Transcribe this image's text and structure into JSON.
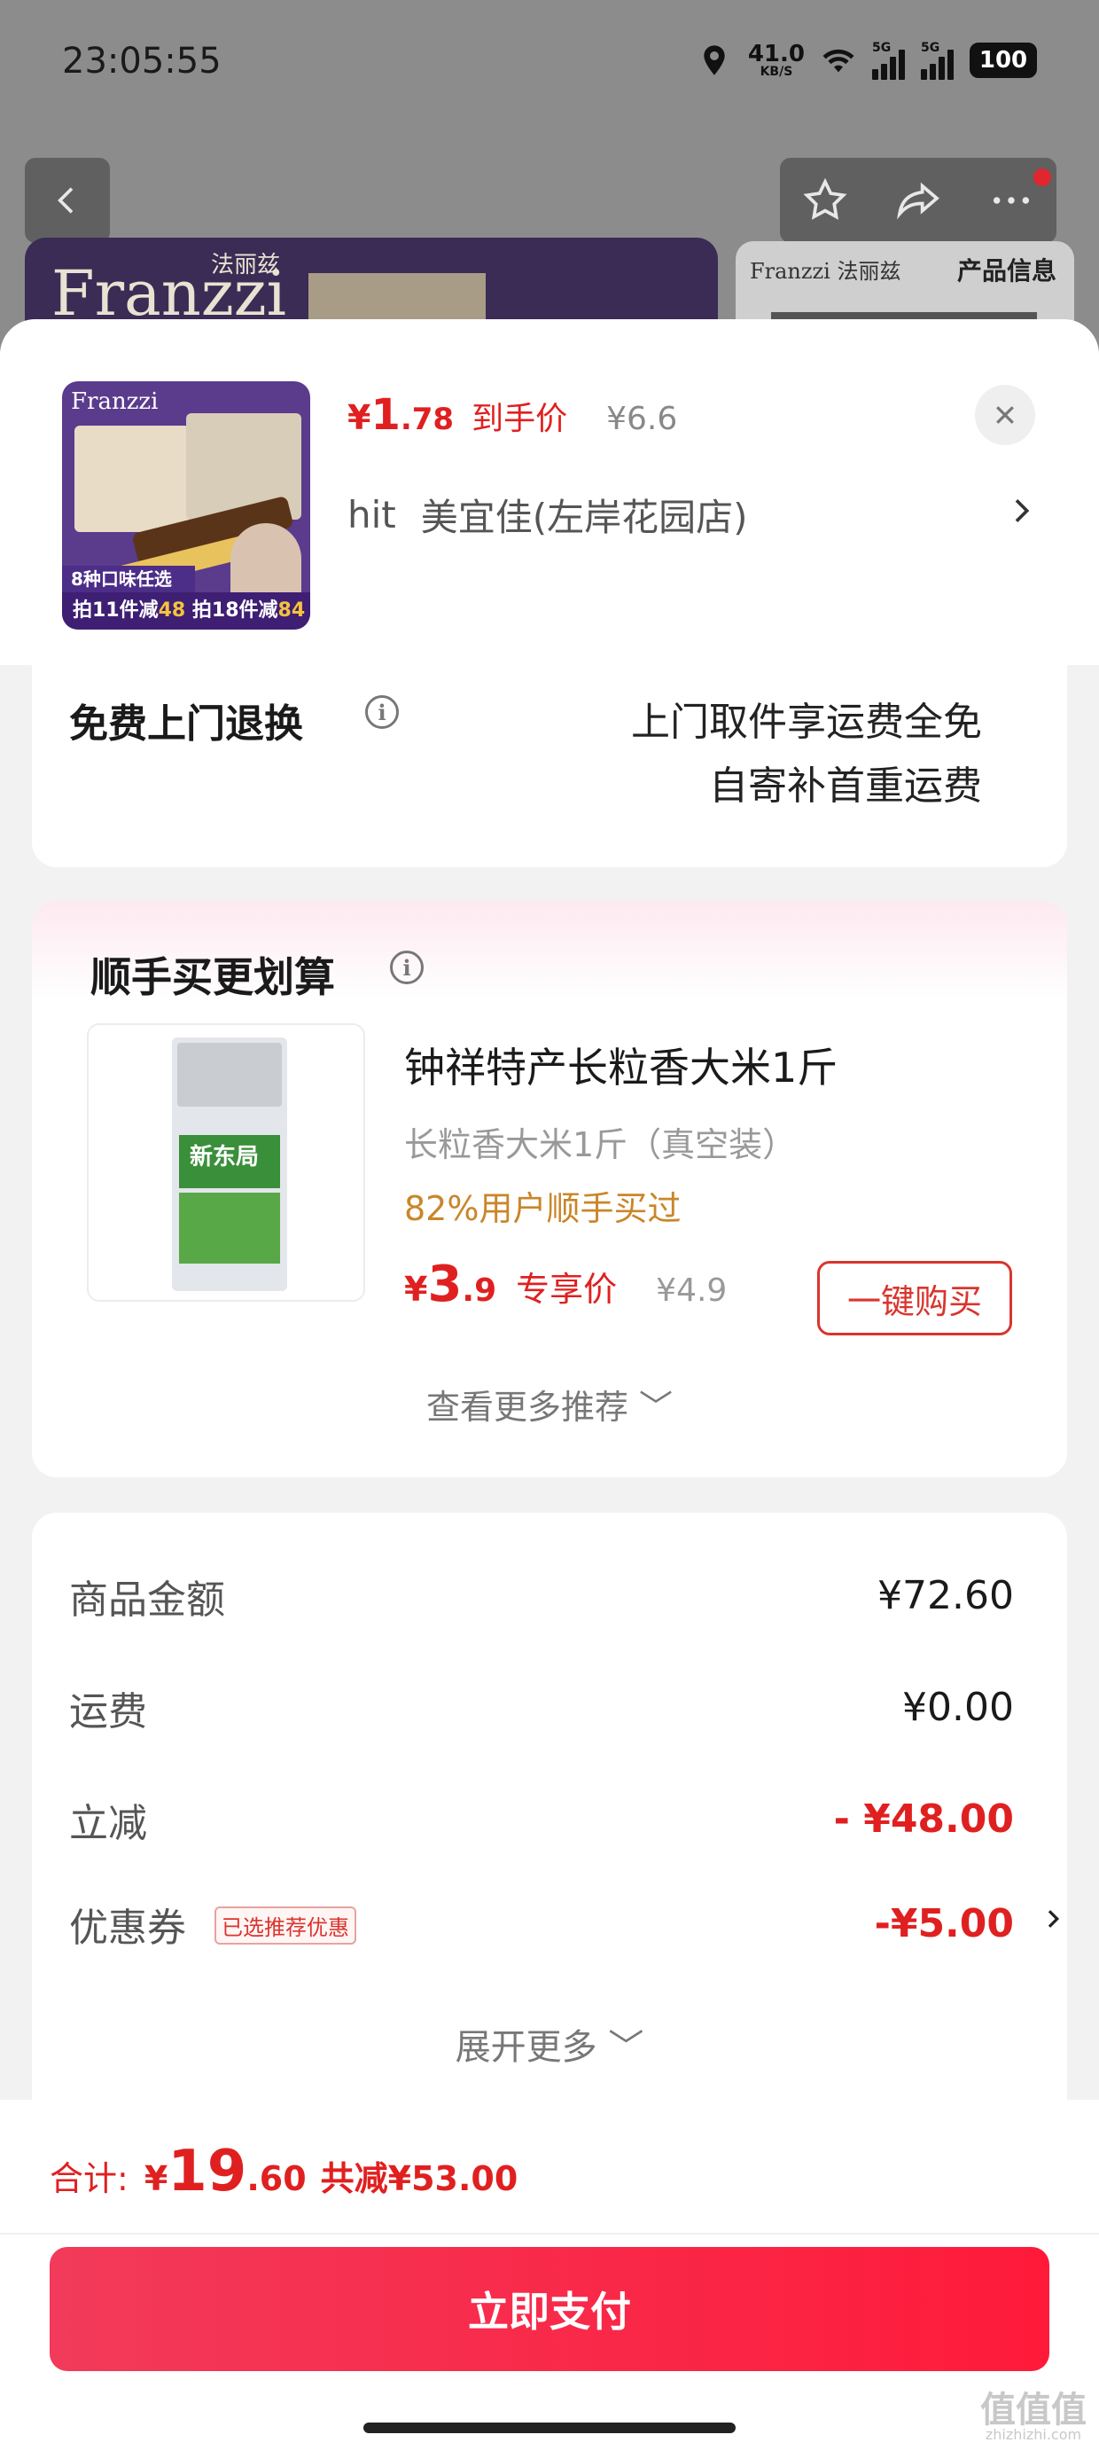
{
  "status_bar": {
    "time": "23:05:55",
    "net_speed_value": "41.0",
    "net_speed_unit": "KB/S",
    "sim1_label": "5G",
    "sim2_label": "5G",
    "battery": "100"
  },
  "background": {
    "brand": "Franzzi",
    "brand_cn": "法丽兹",
    "right_brand": "Franzzi 法丽兹",
    "right_title": "产品信息"
  },
  "product": {
    "thumb_brand": "Franzzi",
    "thumb_badge": "8种口味任选",
    "thumb_foot_a": "拍11件减",
    "thumb_foot_a_num": "48",
    "thumb_foot_b": "拍18件减",
    "thumb_foot_b_num": "84",
    "price_currency": "¥",
    "price_int": "1",
    "price_dec": ".78",
    "price_tag": "到手价",
    "orig_price": "¥6.6",
    "store_prefix": "hit",
    "store_name": "美宜佳(左岸花园店)"
  },
  "return_policy": {
    "title": "免费上门退换",
    "line1": "上门取件享运费全免",
    "line2": "自寄补首重运费"
  },
  "recommend": {
    "title": "顺手买更划算",
    "item_logo": "新东局",
    "item_name": "钟祥特产长粒香大米1斤",
    "item_spec": "长粒香大米1斤（真空装）",
    "item_bought": "82%用户顺手买过",
    "price_currency": "¥",
    "price_int": "3",
    "price_dec": ".9",
    "price_tag": "专享价",
    "orig_price": "¥4.9",
    "buy_label": "一键购买",
    "more_label": "查看更多推荐 ﹀"
  },
  "summary": {
    "rows": [
      {
        "label": "商品金额",
        "value": "¥72.60"
      },
      {
        "label": "运费",
        "value": "¥0.00"
      },
      {
        "label": "立减",
        "value": "- ¥48.00"
      },
      {
        "label": "优惠券",
        "value": "-¥5.00"
      }
    ],
    "coupon_badge": "已选推荐优惠",
    "expand_label": "展开更多 ﹀"
  },
  "footer": {
    "total_label": "合计:",
    "total_currency": "¥",
    "total_int": "19",
    "total_dec": ".60",
    "discount": "共减¥53.00",
    "pay_label": "立即支付",
    "watermark": "值值值",
    "watermark_url": "zhizhizhi.com"
  },
  "colors": {
    "accent_red": "#e02020",
    "pay_button": "#ff1a3a",
    "bought_orange": "#c9862a"
  }
}
